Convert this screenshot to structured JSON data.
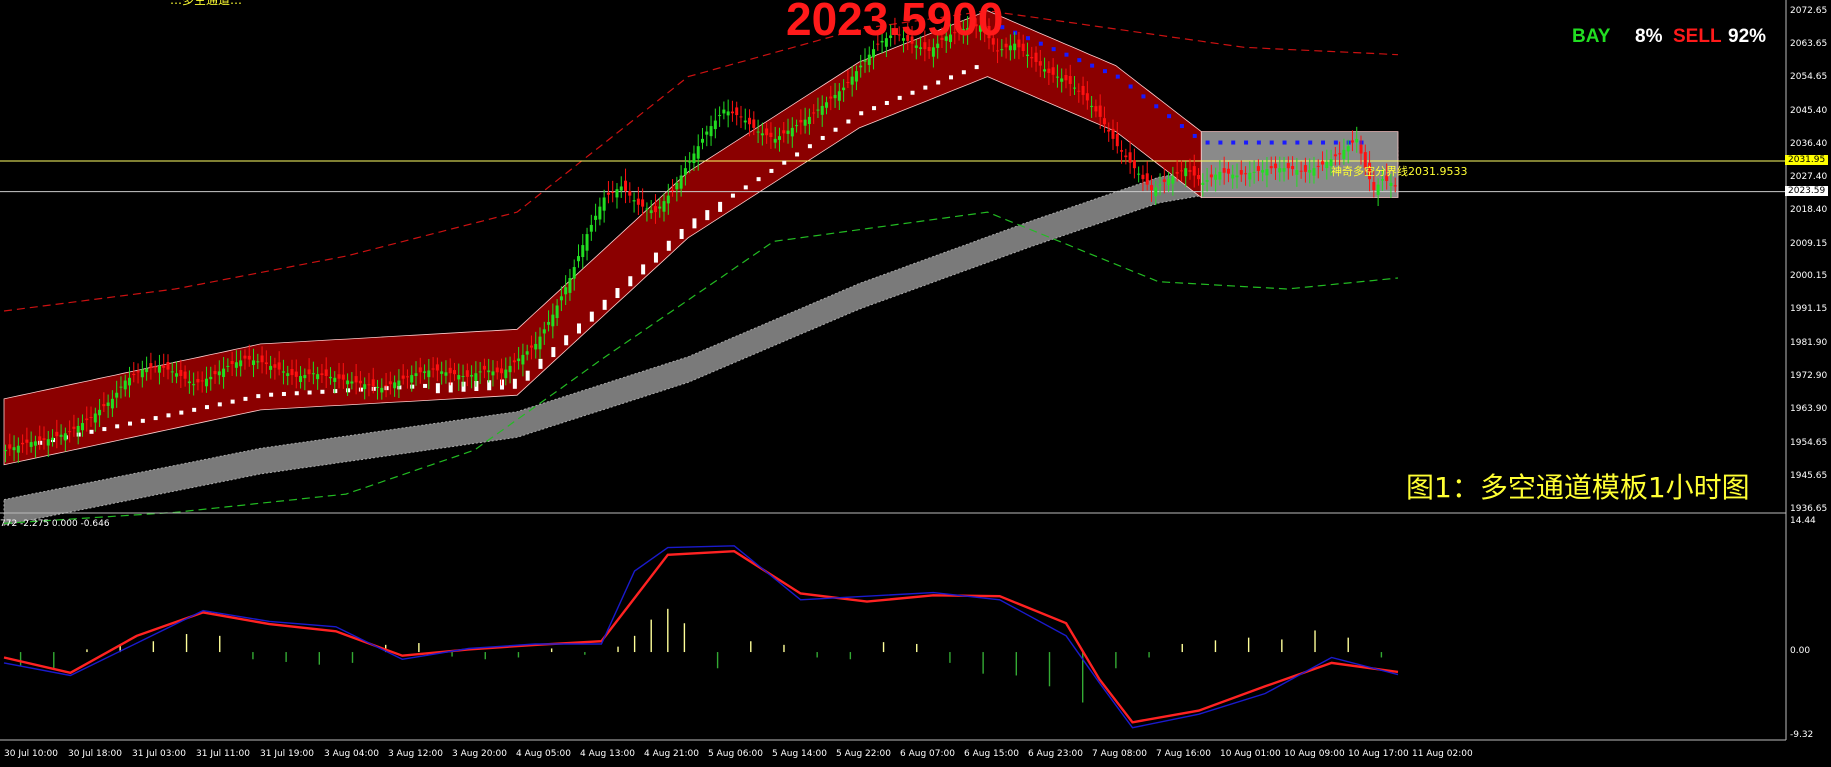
{
  "top_note": "…多空通道…",
  "headline_price": "2023.5900",
  "sentiment": {
    "bay_label": "BAY",
    "bay_pct": "8%",
    "sell_label": "SELL",
    "sell_pct": "92%"
  },
  "caption": "图1：多空通道模板1小时图",
  "boundary_label": "神奇多空分界线2031.9533",
  "osc_label": "772 -2.275 0.000 -0.646",
  "colors": {
    "bull_candle": "#22dd22",
    "bear_candle": "#ff1111",
    "band_fill": "#8b0000",
    "grey_band": "#7a7a7a",
    "white_dots": "#ffffff",
    "blue_dots": "#1a1aff",
    "magenta": "#ff22ff",
    "macd_red": "#ff2222",
    "macd_blue": "#1a1acc"
  },
  "chart_data": [
    {
      "type": "candlestick",
      "title": "",
      "price_axis_ticks": [
        "2072.65",
        "2063.65",
        "2054.65",
        "2045.40",
        "2036.40",
        "2027.40",
        "2018.40",
        "2009.15",
        "2000.15",
        "1991.15",
        "1981.90",
        "1972.90",
        "1963.90",
        "1954.65",
        "1945.65",
        "1936.65"
      ],
      "price_tags": [
        "2031.95",
        "2023.59"
      ],
      "horizontal_lines": [
        2031.95,
        2023.59
      ],
      "ylim": [
        1936.65,
        2072.65
      ],
      "x_labels": [
        "30 Jul 10:00",
        "30 Jul 18:00",
        "31 Jul 03:00",
        "31 Jul 11:00",
        "31 Jul 19:00",
        "3 Aug 04:00",
        "3 Aug 12:00",
        "3 Aug 20:00",
        "4 Aug 05:00",
        "4 Aug 13:00",
        "4 Aug 21:00",
        "5 Aug 06:00",
        "5 Aug 14:00",
        "5 Aug 22:00",
        "6 Aug 07:00",
        "6 Aug 15:00",
        "6 Aug 23:00",
        "7 Aug 08:00",
        "7 Aug 16:00",
        "10 Aug 01:00",
        "10 Aug 09:00",
        "10 Aug 17:00",
        "11 Aug 02:00"
      ],
      "close_path": [
        [
          0,
          1953
        ],
        [
          5,
          1955
        ],
        [
          10,
          1956
        ],
        [
          15,
          1958
        ],
        [
          20,
          1962
        ],
        [
          25,
          1967
        ],
        [
          28,
          1972
        ],
        [
          32,
          1975
        ],
        [
          36,
          1976
        ],
        [
          40,
          1974
        ],
        [
          44,
          1971
        ],
        [
          48,
          1973
        ],
        [
          52,
          1976
        ],
        [
          56,
          1978
        ],
        [
          60,
          1977
        ],
        [
          64,
          1975
        ],
        [
          68,
          1973
        ],
        [
          72,
          1974
        ],
        [
          76,
          1973
        ],
        [
          80,
          1972
        ],
        [
          84,
          1971
        ],
        [
          88,
          1970
        ],
        [
          92,
          1972
        ],
        [
          96,
          1974
        ],
        [
          100,
          1975
        ],
        [
          104,
          1974
        ],
        [
          108,
          1973
        ],
        [
          112,
          1975
        ],
        [
          116,
          1974
        ],
        [
          120,
          1978
        ],
        [
          124,
          1982
        ],
        [
          128,
          1990
        ],
        [
          132,
          2000
        ],
        [
          136,
          2012
        ],
        [
          140,
          2022
        ],
        [
          144,
          2025
        ],
        [
          148,
          2020
        ],
        [
          152,
          2018
        ],
        [
          156,
          2024
        ],
        [
          160,
          2032
        ],
        [
          164,
          2040
        ],
        [
          168,
          2046
        ],
        [
          172,
          2044
        ],
        [
          176,
          2040
        ],
        [
          180,
          2038
        ],
        [
          184,
          2041
        ],
        [
          188,
          2044
        ],
        [
          192,
          2048
        ],
        [
          196,
          2052
        ],
        [
          200,
          2058
        ],
        [
          204,
          2064
        ],
        [
          208,
          2067
        ],
        [
          212,
          2064
        ],
        [
          216,
          2062
        ],
        [
          220,
          2066
        ],
        [
          224,
          2068
        ],
        [
          228,
          2069
        ],
        [
          232,
          2062
        ],
        [
          236,
          2064
        ],
        [
          240,
          2060
        ],
        [
          244,
          2056
        ],
        [
          248,
          2054
        ],
        [
          252,
          2050
        ],
        [
          256,
          2044
        ],
        [
          260,
          2036
        ],
        [
          264,
          2030
        ],
        [
          268,
          2024
        ],
        [
          272,
          2027
        ],
        [
          276,
          2030
        ],
        [
          280,
          2026
        ],
        [
          284,
          2029
        ],
        [
          288,
          2028
        ],
        [
          292,
          2029
        ],
        [
          296,
          2030
        ],
        [
          300,
          2030
        ],
        [
          304,
          2029
        ],
        [
          308,
          2031
        ],
        [
          312,
          2034
        ],
        [
          316,
          2038
        ],
        [
          318,
          2030
        ],
        [
          320,
          2024
        ],
        [
          322,
          2027
        ],
        [
          324,
          2026
        ],
        [
          326,
          2024
        ]
      ],
      "n_bars": 326,
      "channel_mid": [
        [
          0,
          1958
        ],
        [
          60,
          1973
        ],
        [
          120,
          1977
        ],
        [
          160,
          2020
        ],
        [
          200,
          2050
        ],
        [
          230,
          2064
        ],
        [
          260,
          2049
        ],
        [
          280,
          2031
        ],
        [
          326,
          2031
        ]
      ],
      "channel_half_width": 9,
      "outer_dashed_red": [
        [
          0,
          1991
        ],
        [
          40,
          1997
        ],
        [
          80,
          2006
        ],
        [
          120,
          2018
        ],
        [
          160,
          2055
        ],
        [
          200,
          2068
        ],
        [
          230,
          2073
        ],
        [
          260,
          2068
        ],
        [
          290,
          2063
        ],
        [
          326,
          2061
        ]
      ],
      "outer_dashed_green": [
        [
          0,
          1933
        ],
        [
          40,
          1936
        ],
        [
          80,
          1941
        ],
        [
          110,
          1953
        ],
        [
          140,
          1978
        ],
        [
          180,
          2010
        ],
        [
          230,
          2018
        ],
        [
          270,
          1999
        ],
        [
          300,
          1997
        ],
        [
          326,
          2000
        ]
      ],
      "grey_band": [
        [
          0,
          1936
        ],
        [
          60,
          1950
        ],
        [
          120,
          1960
        ],
        [
          160,
          1975
        ],
        [
          200,
          1995
        ],
        [
          240,
          2012
        ],
        [
          270,
          2024
        ],
        [
          300,
          2030
        ],
        [
          326,
          2032
        ]
      ],
      "grey_band_width": 7,
      "bay_pct": 8,
      "sell_pct": 92
    },
    {
      "type": "line",
      "title": "",
      "y_ticks": [
        "14.44",
        "0.00",
        "-9.32"
      ],
      "ylim": [
        -9.32,
        14.44
      ],
      "series": [
        {
          "name": "",
          "color": "#ff2222",
          "points": [
            [
              0,
              -0.6
            ],
            [
              20,
              -2.3
            ],
            [
              40,
              1.8
            ],
            [
              60,
              4.4
            ],
            [
              80,
              3.1
            ],
            [
              100,
              2.3
            ],
            [
              120,
              -0.4
            ],
            [
              140,
              0.3
            ],
            [
              160,
              0.8
            ],
            [
              180,
              1.2
            ],
            [
              190,
              6
            ],
            [
              200,
              10.8
            ],
            [
              220,
              11.2
            ],
            [
              240,
              6.5
            ],
            [
              260,
              5.6
            ],
            [
              280,
              6.3
            ],
            [
              300,
              6.2
            ],
            [
              320,
              3.2
            ],
            [
              330,
              -3.0
            ],
            [
              340,
              -7.8
            ],
            [
              360,
              -6.5
            ],
            [
              380,
              -3.8
            ],
            [
              400,
              -1.2
            ],
            [
              420,
              -2.2
            ]
          ]
        },
        {
          "name": "",
          "color": "#1a1acc",
          "points": [
            [
              0,
              -1.2
            ],
            [
              20,
              -2.6
            ],
            [
              40,
              1.0
            ],
            [
              60,
              4.6
            ],
            [
              80,
              3.4
            ],
            [
              100,
              2.8
            ],
            [
              120,
              -0.8
            ],
            [
              140,
              0.4
            ],
            [
              160,
              0.9
            ],
            [
              180,
              0.9
            ],
            [
              190,
              9
            ],
            [
              200,
              11.6
            ],
            [
              220,
              11.8
            ],
            [
              240,
              5.8
            ],
            [
              260,
              6.2
            ],
            [
              280,
              6.6
            ],
            [
              300,
              5.8
            ],
            [
              320,
              1.8
            ],
            [
              330,
              -3.4
            ],
            [
              340,
              -8.4
            ],
            [
              360,
              -6.9
            ],
            [
              380,
              -4.6
            ],
            [
              400,
              -0.6
            ],
            [
              420,
              -2.5
            ]
          ]
        }
      ],
      "histogram": [
        [
          5,
          -1.5
        ],
        [
          15,
          -1.8
        ],
        [
          25,
          0.3
        ],
        [
          35,
          0.8
        ],
        [
          45,
          1.2
        ],
        [
          55,
          2.0
        ],
        [
          65,
          1.8
        ],
        [
          75,
          -0.8
        ],
        [
          85,
          -1.1
        ],
        [
          95,
          -1.4
        ],
        [
          105,
          -1.2
        ],
        [
          115,
          0.8
        ],
        [
          125,
          1.0
        ],
        [
          135,
          -0.5
        ],
        [
          145,
          -0.8
        ],
        [
          155,
          -0.6
        ],
        [
          165,
          0.4
        ],
        [
          175,
          -0.3
        ],
        [
          185,
          0.6
        ],
        [
          190,
          1.8
        ],
        [
          195,
          3.6
        ],
        [
          200,
          4.8
        ],
        [
          205,
          3.2
        ],
        [
          215,
          -1.8
        ],
        [
          225,
          1.2
        ],
        [
          235,
          0.8
        ],
        [
          245,
          -0.6
        ],
        [
          255,
          -0.8
        ],
        [
          265,
          1.1
        ],
        [
          275,
          0.9
        ],
        [
          285,
          -1.2
        ],
        [
          295,
          -2.4
        ],
        [
          305,
          -2.6
        ],
        [
          315,
          -3.8
        ],
        [
          325,
          -5.6
        ],
        [
          335,
          -1.8
        ],
        [
          345,
          -0.6
        ],
        [
          355,
          0.9
        ],
        [
          365,
          1.3
        ],
        [
          375,
          1.6
        ],
        [
          385,
          1.4
        ],
        [
          395,
          2.4
        ],
        [
          405,
          1.6
        ],
        [
          415,
          -0.6
        ]
      ],
      "hist_n": 420
    }
  ]
}
